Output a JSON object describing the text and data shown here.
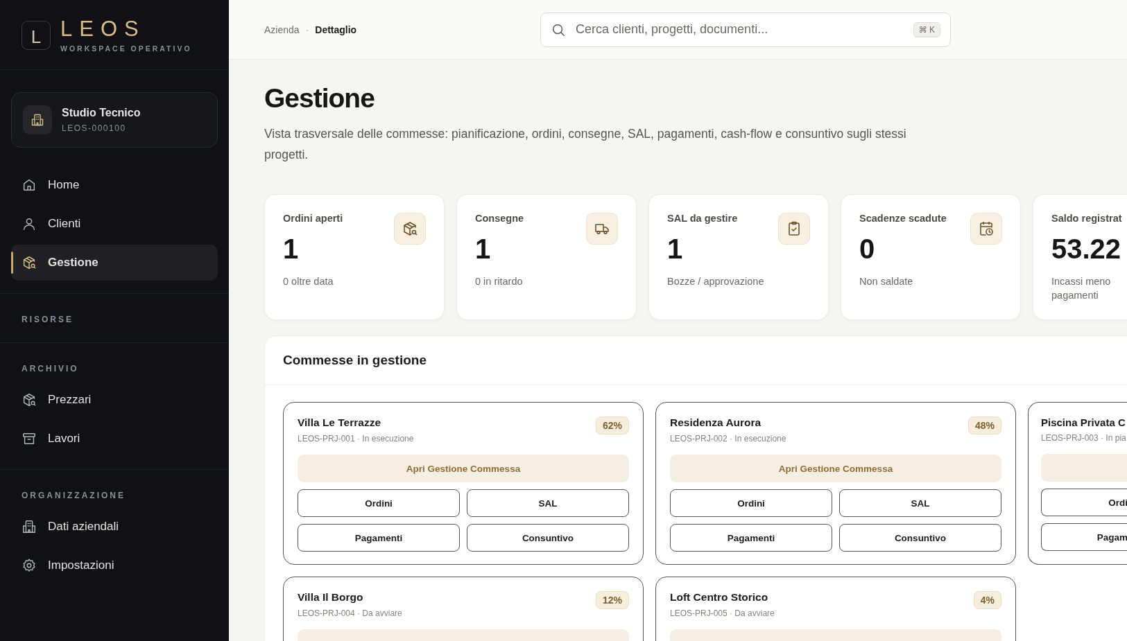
{
  "sidebar": {
    "logo": {
      "mark": "L",
      "name": "LEOS",
      "tagline": "WORKSPACE OPERATIVO"
    },
    "workspace": {
      "name": "Studio Tecnico",
      "code": "LEOS-000100"
    },
    "sections": [
      {
        "items": [
          {
            "label": "Home",
            "selected": false
          },
          {
            "label": "Clienti",
            "selected": false
          },
          {
            "label": "Gestione",
            "selected": true
          }
        ]
      },
      {
        "title": "RISORSE"
      },
      {
        "title": "ARCHIVIO",
        "items": [
          {
            "label": "Prezzari",
            "selected": false
          },
          {
            "label": "Lavori",
            "selected": false
          }
        ]
      },
      {
        "title": "ORGANIZZAZIONE",
        "items": [
          {
            "label": "Dati aziendali",
            "selected": false
          },
          {
            "label": "Impostazioni",
            "selected": false
          }
        ]
      }
    ]
  },
  "topbar": {
    "breadcrumb": [
      "Azienda",
      "Dettaglio"
    ],
    "breadcrumb_separator": "·",
    "search": {
      "placeholder": "Cerca clienti, progetti, documenti...",
      "shortcut": "⌘ K"
    }
  },
  "page": {
    "title": "Gestione",
    "description": "Vista trasversale delle commesse: pianificazione, ordini, consegne, SAL, pagamenti, cash-flow e consuntivo sugli stessi progetti."
  },
  "stats": [
    {
      "label": "Ordini aperti",
      "value": "1",
      "note": "0 oltre data"
    },
    {
      "label": "Consegne",
      "value": "1",
      "note": "0 in ritardo"
    },
    {
      "label": "SAL da gestire",
      "value": "1",
      "note": "Bozze / approvazione"
    },
    {
      "label": "Scadenze scadute",
      "value": "0",
      "note": "Non saldate"
    },
    {
      "label": "Saldo registrat",
      "value": "53.22",
      "note": "Incassi meno pagamenti"
    }
  ],
  "projects_panel": {
    "title": "Commesse in gestione",
    "projects": [
      {
        "kind": "full",
        "name": "Villa Le Terrazze",
        "subtitle": "LEOS-PRJ-001 · In esecuzione",
        "percent": "62%",
        "open": "Apri Gestione Commessa",
        "buttons": [
          "Ordini",
          "SAL",
          "Pagamenti",
          "Consuntivo"
        ]
      },
      {
        "kind": "full",
        "name": "Residenza Aurora",
        "subtitle": "LEOS-PRJ-002 · In esecuzione",
        "percent": "48%",
        "open": "Apri Gestione Commessa",
        "buttons": [
          "Ordini",
          "SAL",
          "Pagamenti",
          "Consuntivo"
        ]
      },
      {
        "kind": "cut",
        "name": "Piscina Privata C",
        "subtitle": "LEOS-PRJ-003 · In pia",
        "buttons": [
          "Ordi",
          "Pagam"
        ]
      },
      {
        "kind": "peek",
        "name": "Villa Il Borgo",
        "subtitle": "LEOS-PRJ-004 · Da avviare",
        "percent": "12%"
      },
      {
        "kind": "peek",
        "name": "Loft Centro Storico",
        "subtitle": "LEOS-PRJ-005 · Da avviare",
        "percent": "4%"
      }
    ]
  }
}
